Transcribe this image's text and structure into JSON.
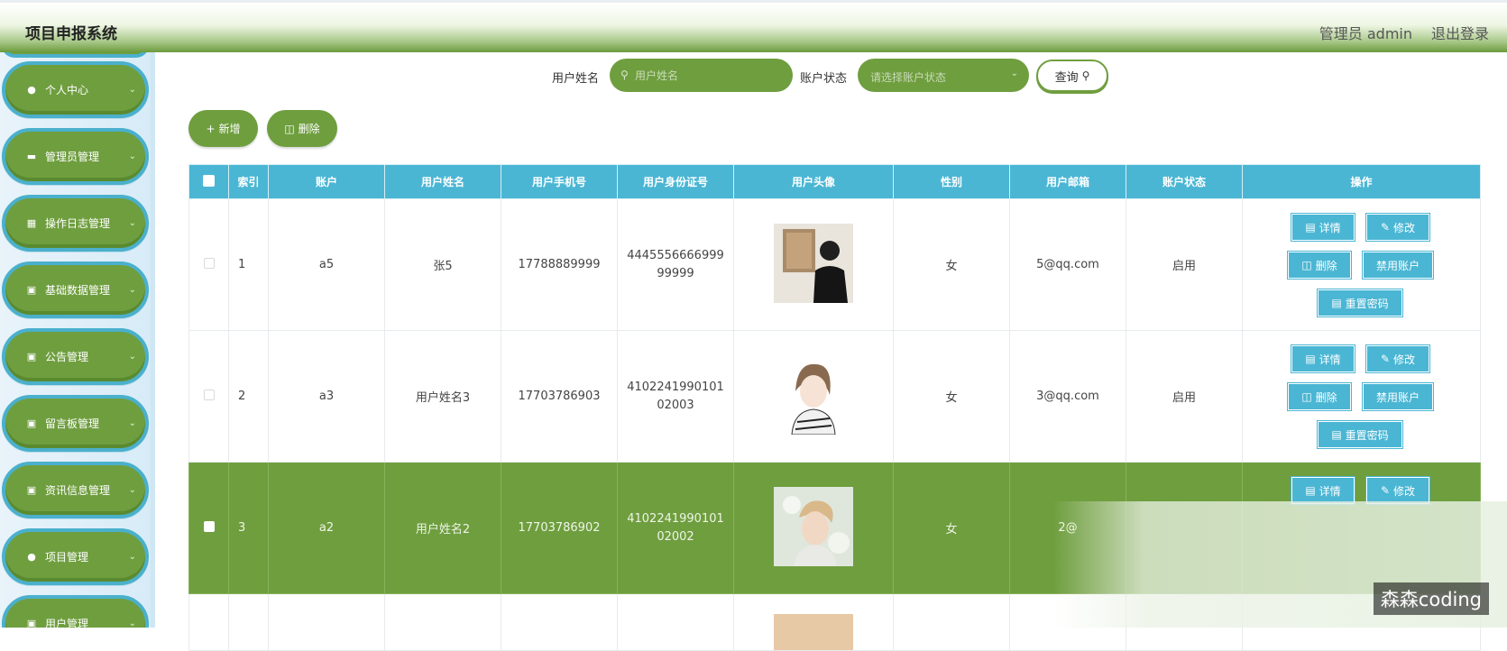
{
  "header": {
    "brand": "项目申报系统",
    "admin": "管理员 admin",
    "logout": "退出登录"
  },
  "sidebar": {
    "items": [
      {
        "label": "个人中心",
        "icon": "person-icon"
      },
      {
        "label": "管理员管理",
        "icon": "monitor-icon"
      },
      {
        "label": "操作日志管理",
        "icon": "clipboard-icon"
      },
      {
        "label": "基础数据管理",
        "icon": "grid-icon"
      },
      {
        "label": "公告管理",
        "icon": "grid-icon"
      },
      {
        "label": "留言板管理",
        "icon": "grid-icon"
      },
      {
        "label": "资讯信息管理",
        "icon": "grid-icon"
      },
      {
        "label": "项目管理",
        "icon": "person-icon"
      },
      {
        "label": "用户管理",
        "icon": "grid-icon"
      }
    ]
  },
  "search": {
    "name_label": "用户姓名",
    "name_placeholder": "用户姓名",
    "status_label": "账户状态",
    "status_placeholder": "请选择账户状态",
    "query_label": "查询"
  },
  "actions": {
    "add": "新增",
    "delete": "删除"
  },
  "table": {
    "headers": [
      "索引",
      "账户",
      "用户姓名",
      "用户手机号",
      "用户身份证号",
      "用户头像",
      "性别",
      "用户邮箱",
      "账户状态",
      "操作"
    ],
    "rows": [
      {
        "index": "1",
        "account": "a5",
        "name": "张5",
        "phone": "17788889999",
        "id_number": "444555666699999999",
        "gender": "女",
        "email": "5@qq.com",
        "status": "启用"
      },
      {
        "index": "2",
        "account": "a3",
        "name": "用户姓名3",
        "phone": "17703786903",
        "id_number": "410224199010102003",
        "gender": "女",
        "email": "3@qq.com",
        "status": "启用"
      },
      {
        "index": "3",
        "account": "a2",
        "name": "用户姓名2",
        "phone": "17703786902",
        "id_number": "410224199010102002",
        "gender": "女",
        "email": "2@",
        "status": ""
      }
    ],
    "ops": {
      "detail": "详情",
      "edit": "修改",
      "delete": "删除",
      "disable": "禁用账户",
      "reset": "重置密码"
    }
  },
  "watermark": "森森coding"
}
